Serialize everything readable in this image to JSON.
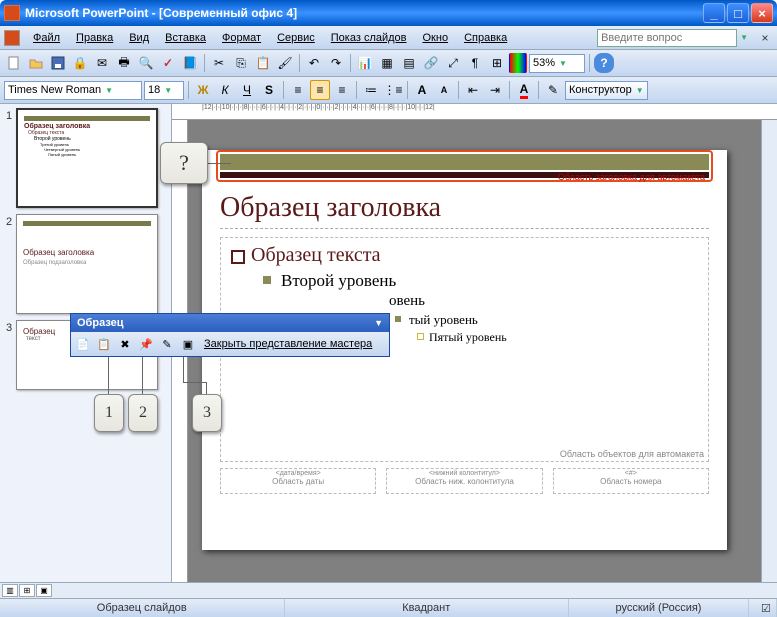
{
  "title": "Microsoft PowerPoint - [Современный офис 4]",
  "menu": {
    "file": "Файл",
    "edit": "Правка",
    "view": "Вид",
    "insert": "Вставка",
    "format": "Формат",
    "service": "Сервис",
    "show": "Показ слайдов",
    "window": "Окно",
    "help": "Справка"
  },
  "question_placeholder": "Введите вопрос",
  "zoom": "53%",
  "font": {
    "name": "Times New Roman",
    "size": "18"
  },
  "format_buttons": {
    "bold": "Ж",
    "italic": "К",
    "underline": "Ч",
    "shadow": "S"
  },
  "designer": "Конструктор",
  "ruler": "|12|·|·|10|·|·|·|8|·|·|·|6|·|·|·|4|·|·|·|2|·|·|·|0|·|·|·|2|·|·|·|4|·|·|·|6|·|·|·|8|·|·|·|10|·|·|12|",
  "thumbs": {
    "t1": {
      "title": "Образец заголовка",
      "l1": "Образец текста",
      "l2": "Второй уровень",
      "l3": "Третий уровень",
      "l4": "Четвертый уровень",
      "l5": "Пятый уровень"
    },
    "t2": {
      "title": "Образец заголовка",
      "sub": "Образец подзаголовка"
    },
    "t3": {
      "title": "Образец",
      "sub": "текст"
    }
  },
  "slide": {
    "title_caption": "Область заголовка для автомакета",
    "title": "Образец заголовка",
    "b1": "Образец текста",
    "b2": "Второй уровень",
    "b3": "овень",
    "b4": "тый уровень",
    "b5": "Пятый уровень",
    "body_caption": "Область объектов для автомакета",
    "f1h": "<дата/время>",
    "f1": "Область даты",
    "f2h": "<нижний колонтитул>",
    "f2": "Область ниж. колонтитула",
    "f3h": "<#>",
    "f3": "Область номера"
  },
  "master_tb": {
    "title": "Образец",
    "close": "Закрыть представление мастера"
  },
  "callouts": {
    "q": "?",
    "n1": "1",
    "n2": "2",
    "n3": "3"
  },
  "status": {
    "s1": "Образец слайдов",
    "s2": "Квадрант",
    "s3": "русский (Россия)"
  }
}
